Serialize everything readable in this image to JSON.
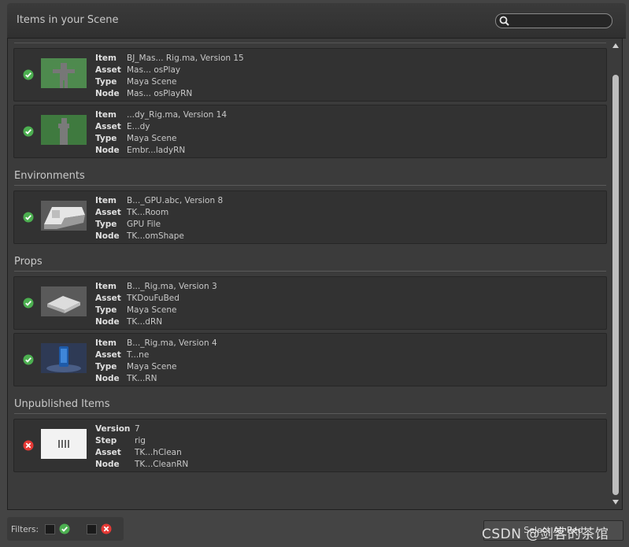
{
  "header": {
    "title": "Items in your Scene",
    "search_placeholder": ""
  },
  "sections": {
    "environments": "Environments",
    "props": "Props",
    "unpublished": "Unpublished Items"
  },
  "labels": {
    "item": "Item",
    "asset": "Asset",
    "type": "Type",
    "node": "Node",
    "version": "Version",
    "step": "Step"
  },
  "items": [
    {
      "status": "ok",
      "item": "BJ_Mas... Rig.ma, Version 15",
      "asset": "Mas... osPlay",
      "type": "Maya Scene",
      "node": "Mas... osPlayRN"
    },
    {
      "status": "ok",
      "item": "...dy_Rig.ma, Version 14",
      "asset": "E...dy",
      "type": "Maya Scene",
      "node": "Embr...ladyRN"
    },
    {
      "status": "ok",
      "item": "B..._GPU.abc, Version 8",
      "asset": "TK...Room",
      "type": "GPU File",
      "node": "TK...omShape"
    },
    {
      "status": "ok",
      "item": "B..._Rig.ma, Version 3",
      "asset": "TKDouFuBed",
      "type": "Maya Scene",
      "node": "TK...dRN"
    },
    {
      "status": "ok",
      "item": "B..._Rig.ma, Version 4",
      "asset": "T...ne",
      "type": "Maya Scene",
      "node": "TK...RN"
    }
  ],
  "unpublished_item": {
    "status": "error",
    "version": "7",
    "step": "rig",
    "asset": "TK...hClean",
    "node": "TK...CleanRN"
  },
  "footer": {
    "filters_label": "Filters:",
    "button_label": "Select All Red"
  },
  "watermark": "CSDN @剑客的茶馆",
  "colors": {
    "ok": "#4caf50",
    "error": "#e53935",
    "background": "#444444",
    "card": "#323232"
  }
}
